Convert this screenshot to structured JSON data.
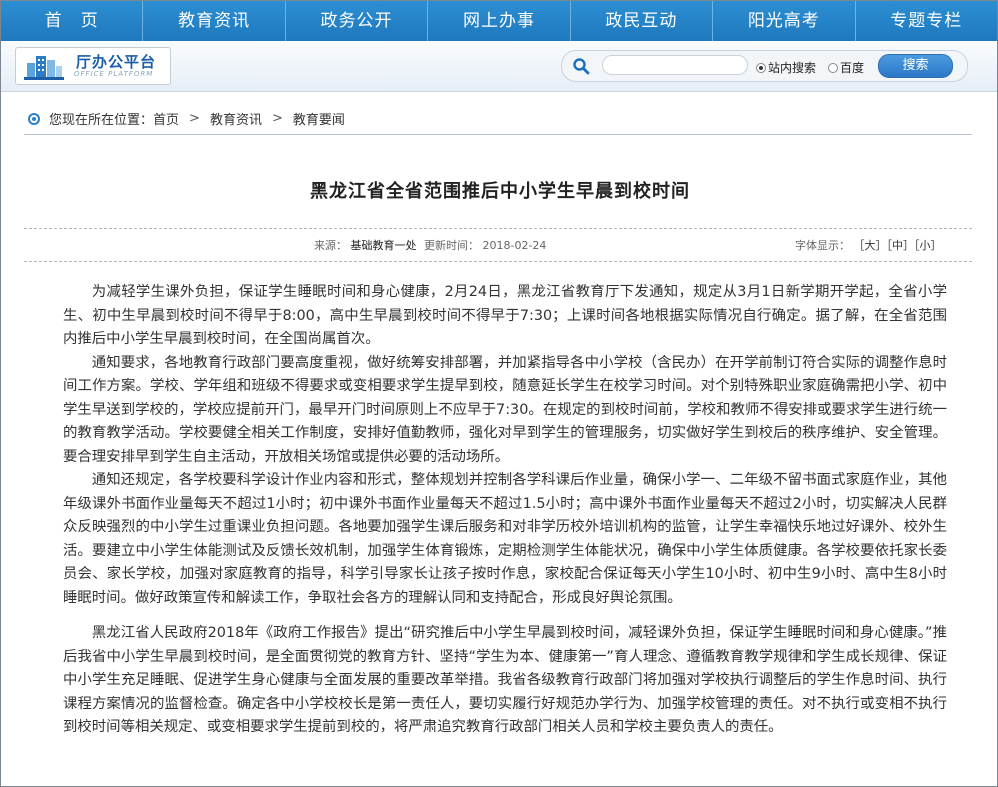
{
  "nav": {
    "items": [
      "首　页",
      "教育资讯",
      "政务公开",
      "网上办事",
      "政民互动",
      "阳光高考",
      "专题专栏"
    ]
  },
  "logo": {
    "title": "厅办公平台",
    "subtitle": "OFFICE PLATFORM"
  },
  "search": {
    "value": "",
    "option_site": "站内搜索",
    "option_baidu": "百度",
    "selected": "站内搜索",
    "button": "搜索"
  },
  "breadcrumb": {
    "prefix": "您现在所在位置：",
    "items": [
      "首页",
      "教育资讯",
      "教育要闻"
    ],
    "separator": ">"
  },
  "article": {
    "title": "黑龙江省全省范围推后中小学生早晨到校时间",
    "source_label": "来源：",
    "source": "基础教育一处",
    "updated_label": "更新时间：",
    "updated": "2018-02-24",
    "font_label": "字体显示：",
    "font_large": "［大］",
    "font_medium": "［中］",
    "font_small": "［小］",
    "paragraphs": [
      "为减轻学生课外负担，保证学生睡眠时间和身心健康，2月24日，黑龙江省教育厅下发通知，规定从3月1日新学期开学起，全省小学生、初中生早晨到校时间不得早于8:00，高中生早晨到校时间不得早于7:30；上课时间各地根据实际情况自行确定。据了解，在全省范围内推后中小学生早晨到校时间，在全国尚属首次。",
      "通知要求，各地教育行政部门要高度重视，做好统筹安排部署，并加紧指导各中小学校（含民办）在开学前制订符合实际的调整作息时间工作方案。学校、学年组和班级不得要求或变相要求学生提早到校，随意延长学生在校学习时间。对个别特殊职业家庭确需把小学、初中学生早送到学校的，学校应提前开门，最早开门时间原则上不应早于7:30。在规定的到校时间前，学校和教师不得安排或要求学生进行统一的教育教学活动。学校要健全相关工作制度，安排好值勤教师，强化对早到学生的管理服务，切实做好学生到校后的秩序维护、安全管理。要合理安排早到学生自主活动，开放相关场馆或提供必要的活动场所。",
      "通知还规定，各学校要科学设计作业内容和形式，整体规划并控制各学科课后作业量，确保小学一、二年级不留书面式家庭作业，其他年级课外书面作业量每天不超过1小时；初中课外书面作业量每天不超过1.5小时；高中课外书面作业量每天不超过2小时，切实解决人民群众反映强烈的中小学生过重课业负担问题。各地要加强学生课后服务和对非学历校外培训机构的监管，让学生幸福快乐地过好课外、校外生活。要建立中小学生体能测试及反馈长效机制，加强学生体育锻炼，定期检测学生体能状况，确保中小学生体质健康。各学校要依托家长委员会、家长学校，加强对家庭教育的指导，科学引导家长让孩子按时作息，家校配合保证每天小学生10小时、初中生9小时、高中生8小时睡眠时间。做好政策宣传和解读工作，争取社会各方的理解认同和支持配合，形成良好舆论氛围。",
      "黑龙江省人民政府2018年《政府工作报告》提出“研究推后中小学生早晨到校时间，减轻课外负担，保证学生睡眠时间和身心健康。”推后我省中小学生早晨到校时间，是全面贯彻党的教育方针、坚持“学生为本、健康第一”育人理念、遵循教育教学规律和学生成长规律、保证中小学生充足睡眠、促进学生身心健康与全面发展的重要改革举措。我省各级教育行政部门将加强对学校执行调整后的学生作息时间、执行课程方案情况的监督检查。确定各中小学校校长是第一责任人，要切实履行好规范办学行为、加强学校管理的责任。对不执行或变相不执行到校时间等相关规定、或变相要求学生提前到校的，将严肃追究教育行政部门相关人员和学校主要负责人的责任。"
    ]
  },
  "colors": {
    "nav_bg": "#2c8fd2",
    "accent": "#1c5ea8"
  }
}
